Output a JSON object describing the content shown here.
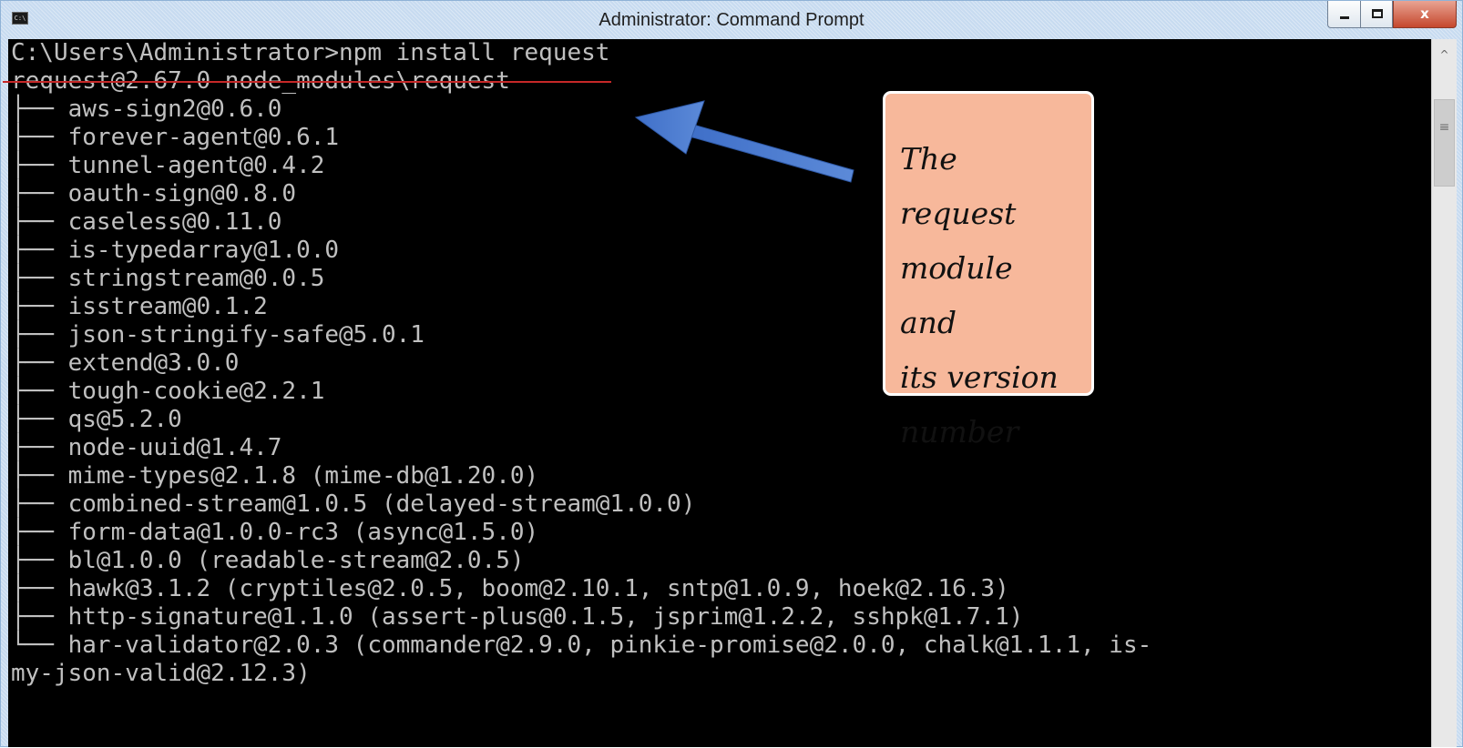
{
  "window": {
    "title": "Administrator: Command Prompt",
    "icon": "cmd-icon",
    "controls": {
      "minimize_icon": "minimize-icon",
      "maximize_icon": "maximize-icon",
      "close_label": "x"
    }
  },
  "console": {
    "lines": [
      "C:\\Users\\Administrator>npm install request",
      "request@2.67.0 node_modules\\request",
      "├── aws-sign2@0.6.0",
      "├── forever-agent@0.6.1",
      "├── tunnel-agent@0.4.2",
      "├── oauth-sign@0.8.0",
      "├── caseless@0.11.0",
      "├── is-typedarray@1.0.0",
      "├── stringstream@0.0.5",
      "├── isstream@0.1.2",
      "├── json-stringify-safe@5.0.1",
      "├── extend@3.0.0",
      "├── tough-cookie@2.2.1",
      "├── qs@5.2.0",
      "├── node-uuid@1.4.7",
      "├── mime-types@2.1.8 (mime-db@1.20.0)",
      "├── combined-stream@1.0.5 (delayed-stream@1.0.0)",
      "├── form-data@1.0.0-rc3 (async@1.5.0)",
      "├── bl@1.0.0 (readable-stream@2.0.5)",
      "├── hawk@3.1.2 (cryptiles@2.0.5, boom@2.10.1, sntp@1.0.9, hoek@2.16.3)",
      "├── http-signature@1.1.0 (assert-plus@0.1.5, jsprim@1.2.2, sshpk@1.7.1)",
      "└── har-validator@2.0.3 (commander@2.9.0, pinkie-promise@2.0.0, chalk@1.1.1, is-",
      "my-json-valid@2.12.3)"
    ]
  },
  "annotation": {
    "lines": [
      "The request",
      "module and",
      "its version",
      "number"
    ],
    "arrow_color": "#4a78d0",
    "box_color": "#f7b89b",
    "underline_color": "#c62828"
  },
  "scrollbar": {
    "up_icon": "scroll-up-arrow-icon",
    "thumb_grip": "≡"
  }
}
